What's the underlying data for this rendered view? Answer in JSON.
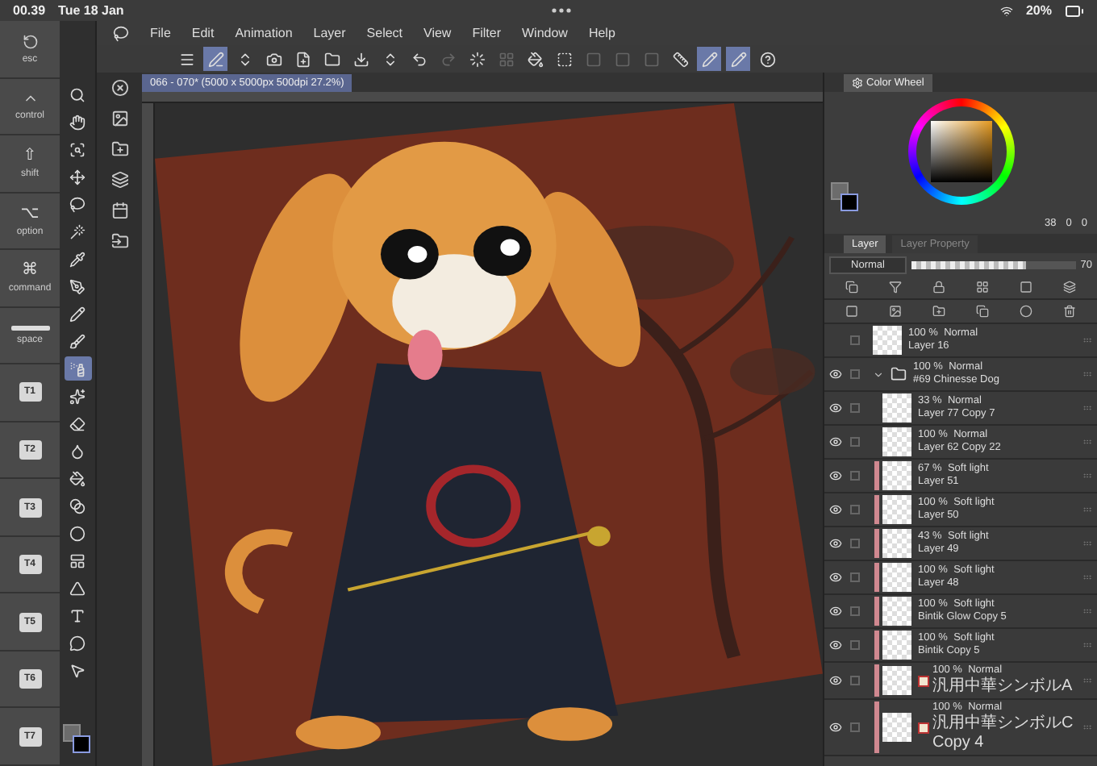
{
  "status_bar": {
    "time": "00.39",
    "date": "Tue 18 Jan",
    "battery": "20%"
  },
  "keys": [
    {
      "kind": "reset",
      "label": "esc"
    },
    {
      "kind": "chevron",
      "label": "control"
    },
    {
      "kind": "glyph",
      "symbol": "⇧",
      "label": "shift"
    },
    {
      "kind": "glyph",
      "symbol": "⌥",
      "label": "option"
    },
    {
      "kind": "glyph",
      "symbol": "⌘",
      "label": "command"
    },
    {
      "kind": "bar",
      "label": "space"
    },
    {
      "kind": "tile",
      "label": "T1"
    },
    {
      "kind": "tile",
      "label": "T2"
    },
    {
      "kind": "tile",
      "label": "T3"
    },
    {
      "kind": "tile",
      "label": "T4"
    },
    {
      "kind": "tile",
      "label": "T5"
    },
    {
      "kind": "tile",
      "label": "T6"
    },
    {
      "kind": "tile",
      "label": "T7"
    }
  ],
  "menu": [
    "File",
    "Edit",
    "Animation",
    "Layer",
    "Select",
    "View",
    "Filter",
    "Window",
    "Help"
  ],
  "toolbar": [
    {
      "selected": false,
      "disabled": false
    },
    {
      "selected": true,
      "disabled": false
    },
    {
      "selected": false,
      "disabled": false
    },
    {
      "selected": false,
      "disabled": false
    },
    {
      "selected": false,
      "disabled": false
    },
    {
      "selected": false,
      "disabled": false
    },
    {
      "selected": false,
      "disabled": false
    },
    {
      "selected": false,
      "disabled": false
    },
    {
      "selected": false,
      "disabled": false
    },
    {
      "selected": false,
      "disabled": true
    },
    {
      "selected": false,
      "disabled": false
    },
    {
      "selected": false,
      "disabled": true
    },
    {
      "selected": false,
      "disabled": false
    },
    {
      "selected": false,
      "disabled": false
    },
    {
      "selected": false,
      "disabled": true
    },
    {
      "selected": false,
      "disabled": true
    },
    {
      "selected": false,
      "disabled": true
    },
    {
      "selected": false,
      "disabled": false
    },
    {
      "selected": true,
      "disabled": false
    },
    {
      "selected": true,
      "disabled": false
    },
    {
      "selected": false,
      "disabled": false
    }
  ],
  "tools": [
    {
      "selected": false
    },
    {
      "selected": false
    },
    {
      "selected": false
    },
    {
      "selected": false
    },
    {
      "selected": false
    },
    {
      "selected": false
    },
    {
      "selected": false
    },
    {
      "selected": false
    },
    {
      "selected": false
    },
    {
      "selected": false
    },
    {
      "selected": true
    },
    {
      "selected": false
    },
    {
      "selected": false
    },
    {
      "selected": false
    },
    {
      "selected": false
    },
    {
      "selected": false
    },
    {
      "selected": false
    },
    {
      "selected": false
    },
    {
      "selected": false
    },
    {
      "selected": false
    },
    {
      "selected": false
    },
    {
      "selected": false
    }
  ],
  "document_tab": {
    "title": "066 - 070* (5000 x 5000px 500dpi 27.2%)"
  },
  "color_panel": {
    "tab": "Color Wheel",
    "readouts": [
      "38",
      "0",
      "0"
    ]
  },
  "layer_panel": {
    "tabs": [
      {
        "label": "Layer",
        "selected": true
      },
      {
        "label": "Layer Property",
        "selected": false
      }
    ],
    "blend": "Normal",
    "opacity_slider": {
      "level": 0.7
    },
    "opacity": "70",
    "layers": [
      {
        "kind": "layer",
        "visible": false,
        "checked": false,
        "clipped": false,
        "opacity": "100 %",
        "blend": "Normal",
        "name": "Layer 16"
      },
      {
        "kind": "folder",
        "visible": true,
        "checked": false,
        "clipped": false,
        "expanded": true,
        "opacity": "100 %",
        "blend": "Normal",
        "name": "#69 Chinesse Dog",
        "children": [
          {
            "kind": "layer",
            "visible": true,
            "checked": false,
            "clipped": false,
            "opacity": "33 %",
            "blend": "Normal",
            "name": "Layer 77 Copy 7"
          },
          {
            "kind": "layer",
            "visible": true,
            "checked": false,
            "clipped": false,
            "opacity": "100 %",
            "blend": "Normal",
            "name": "Layer 62 Copy 22"
          },
          {
            "kind": "layer",
            "visible": true,
            "checked": false,
            "clipped": true,
            "opacity": "67 %",
            "blend": "Soft light",
            "name": "Layer 51"
          },
          {
            "kind": "layer",
            "visible": true,
            "checked": false,
            "clipped": true,
            "opacity": "100 %",
            "blend": "Soft light",
            "name": "Layer 50"
          },
          {
            "kind": "layer",
            "visible": true,
            "checked": false,
            "clipped": true,
            "opacity": "43 %",
            "blend": "Soft light",
            "name": "Layer 49"
          },
          {
            "kind": "layer",
            "visible": true,
            "checked": false,
            "clipped": true,
            "opacity": "100 %",
            "blend": "Soft light",
            "name": "Layer 48"
          },
          {
            "kind": "layer",
            "visible": true,
            "checked": false,
            "clipped": true,
            "opacity": "100 %",
            "blend": "Soft light",
            "name": "Bintik Glow Copy 5"
          },
          {
            "kind": "layer",
            "visible": true,
            "checked": false,
            "clipped": true,
            "opacity": "100 %",
            "blend": "Soft light",
            "name": "Bintik Copy 5"
          },
          {
            "kind": "material",
            "visible": true,
            "checked": false,
            "clipped": true,
            "opacity": "100 %",
            "blend": "Normal",
            "name": "汎用中華シンボルA"
          },
          {
            "kind": "material",
            "visible": true,
            "checked": false,
            "clipped": true,
            "opacity": "100 %",
            "blend": "Normal",
            "name": "汎用中華シンボルC Copy 4"
          }
        ]
      }
    ]
  }
}
